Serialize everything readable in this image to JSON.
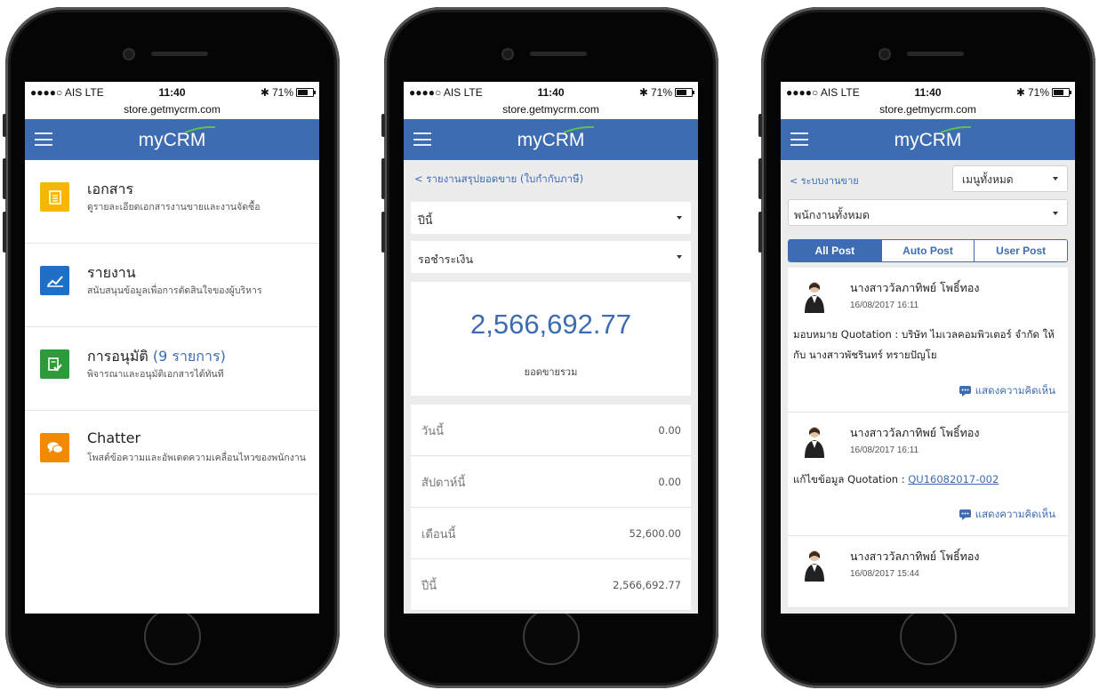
{
  "status_bar": {
    "carrier": "●●●●○ AIS  LTE",
    "time": "11:40",
    "battery": "71%",
    "url": "store.getmycrm.com"
  },
  "app": {
    "logo": "myCRM"
  },
  "colors": {
    "brand": "#3d6cb3",
    "doc_icon": "#f5b800",
    "report_icon": "#1f6fc6",
    "approve_icon": "#2f9a3a",
    "chatter_icon": "#f28a00"
  },
  "home_menu": [
    {
      "icon": "document-icon",
      "title": "เอกสาร",
      "count": "",
      "desc": "ดูรายละเอียดเอกสารงานขายและงานจัดซื้อ"
    },
    {
      "icon": "chart-icon",
      "title": "รายงาน",
      "count": "",
      "desc": "สนับสนุนข้อมูลเพื่อการตัดสินใจของผู้บริหาร"
    },
    {
      "icon": "approve-icon",
      "title": "การอนุมัติ",
      "count": "(9 รายการ)",
      "desc": "พิจารณาและอนุมัติเอกสารได้ทันที"
    },
    {
      "icon": "chat-icon",
      "title": "Chatter",
      "count": "",
      "desc": "โพสต์ข้อความและอัพเดตความเคลื่อนไหวของพนักงาน"
    }
  ],
  "sales_report": {
    "breadcrumb": "< รายงานสรุปยอดขาย (ใบกำกับภาษี)",
    "period_select": "ปีนี้",
    "status_select": "รอชำระเงิน",
    "total_value": "2,566,692.77",
    "total_label": "ยอดขายรวม",
    "rows": [
      {
        "label": "วันนี้",
        "value": "0.00"
      },
      {
        "label": "สัปดาห์นี้",
        "value": "0.00"
      },
      {
        "label": "เดือนนี้",
        "value": "52,600.00"
      },
      {
        "label": "ปีนี้",
        "value": "2,566,692.77"
      }
    ]
  },
  "chatter": {
    "breadcrumb": "< ระบบงานขาย",
    "menu_select": "เมนูทั้งหมด",
    "employee_select": "พนักงานทั้งหมด",
    "tabs": [
      "All Post",
      "Auto Post",
      "User Post"
    ],
    "comment_label": "แสดงความคิดเห็น",
    "posts": [
      {
        "name": "นางสาววัลภาทิพย์ โพธิ์ทอง",
        "time": "16/08/2017 16:11",
        "msg": "มอบหมาย Quotation : บริษัท ไมเวลคอมพิวเตอร์ จำกัด ให้กับ นางสาวพัชรินทร์ ทรายปัญโย",
        "link": ""
      },
      {
        "name": "นางสาววัลภาทิพย์ โพธิ์ทอง",
        "time": "16/08/2017 16:11",
        "msg": "แก้ไขข้อมูล Quotation : ",
        "link": "QU16082017-002"
      },
      {
        "name": "นางสาววัลภาทิพย์ โพธิ์ทอง",
        "time": "16/08/2017 15:44",
        "msg": "",
        "link": ""
      }
    ]
  }
}
